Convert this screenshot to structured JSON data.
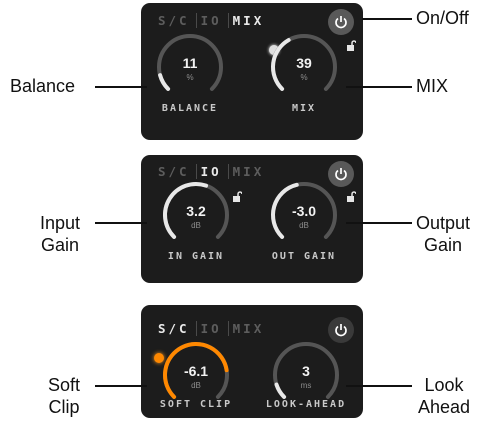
{
  "panels": [
    {
      "tabs": [
        "S/C",
        "IO",
        "MIX"
      ],
      "active_tab": "MIX",
      "left_knob": {
        "value": "11",
        "unit": "%",
        "label": "BALANCE",
        "level": 0.11
      },
      "right_knob": {
        "value": "39",
        "unit": "%",
        "label": "MIX",
        "level": 0.39
      }
    },
    {
      "tabs": [
        "S/C",
        "IO",
        "MIX"
      ],
      "active_tab": "IO",
      "left_knob": {
        "value": "3.2",
        "unit": "dB",
        "label": "IN GAIN",
        "level": 0.57
      },
      "right_knob": {
        "value": "-3.0",
        "unit": "dB",
        "label": "OUT GAIN",
        "level": 0.45
      }
    },
    {
      "tabs": [
        "S/C",
        "IO",
        "MIX"
      ],
      "active_tab": "S/C",
      "left_knob": {
        "value": "-6.1",
        "unit": "dB",
        "label": "SOFT CLIP",
        "level": 0.8
      },
      "right_knob": {
        "value": "3",
        "unit": "ms",
        "label": "LOOK-AHEAD",
        "level": 0.1
      }
    }
  ],
  "callouts": {
    "on_off": "On/Off",
    "balance": "Balance",
    "mix": "MIX",
    "input_gain": [
      "Input",
      "Gain"
    ],
    "output_gain": [
      "Output",
      "Gain"
    ],
    "soft_clip": [
      "Soft",
      "Clip"
    ],
    "look_ahead": [
      "Look",
      "Ahead"
    ]
  },
  "colors": {
    "panel_bg": "#1c1c1c",
    "arc_track": "#555555",
    "arc_white": "#e8e8e8",
    "arc_orange": "#ff8800",
    "power_bg": "#595959"
  },
  "icons": [
    "power-icon",
    "unlock-icon",
    "led-dot"
  ]
}
